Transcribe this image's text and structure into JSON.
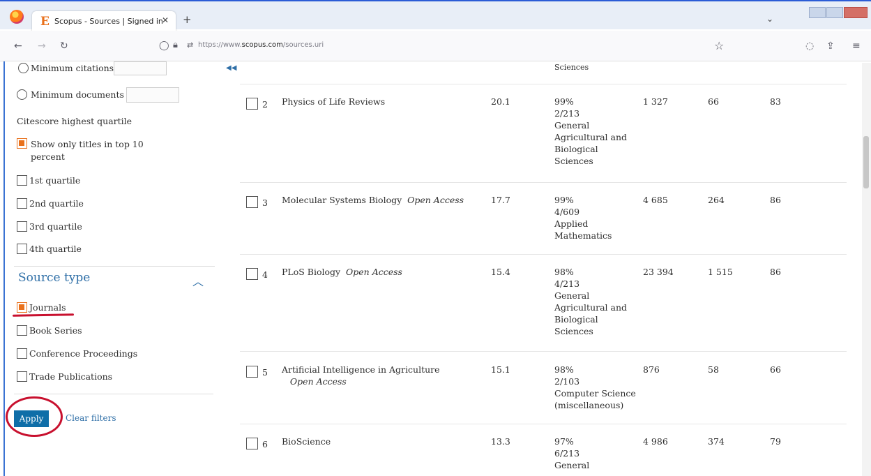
{
  "browser": {
    "tab_favicon": "E",
    "tab_title": "Scopus - Sources | Signed in",
    "tab_close": "✕",
    "new_tab": "+",
    "tab_list": "⌄",
    "url_prefix": "https://www.",
    "url_domain": "scopus.com",
    "url_path": "/sources.uri",
    "icons": [
      "back-icon",
      "forward-icon",
      "reload-icon",
      "shield-icon",
      "lock-icon",
      "permissions-icon",
      "bookmark-star-icon",
      "pocket-icon",
      "share-icon",
      "menu-icon"
    ]
  },
  "filters": {
    "min_citations_label": "Minimum citations",
    "min_documents_label": "Minimum documents",
    "quartile_heading": "Citescore highest quartile",
    "top10_label": "Show only titles in top 10\npercent",
    "quartiles": [
      "1st quartile",
      "2nd quartile",
      "3rd quartile",
      "4th quartile"
    ],
    "source_type_heading": "Source type",
    "source_types": [
      "Journals",
      "Book Series",
      "Conference Proceedings",
      "Trade Publications"
    ],
    "apply_label": "Apply",
    "clear_label": "Clear filters",
    "accent_color": "#2f6fa7",
    "checked_color": "#e9711c",
    "annotation_color": "#c8102e"
  },
  "results": {
    "partial_top_subject": "Sciences",
    "rows": [
      {
        "rank": "2",
        "title": "Physics of Life Reviews",
        "oa": "",
        "citescore": "20.1",
        "percentile": "99%\n2/213\nGeneral\nAgricultural and\nBiological\nSciences",
        "citations": "1 327",
        "documents": "66",
        "cited": "83"
      },
      {
        "rank": "3",
        "title": "Molecular Systems Biology",
        "oa": "Open Access",
        "citescore": "17.7",
        "percentile": "99%\n4/609\nApplied\nMathematics",
        "citations": "4 685",
        "documents": "264",
        "cited": "86"
      },
      {
        "rank": "4",
        "title": "PLoS Biology",
        "oa": "Open Access",
        "citescore": "15.4",
        "percentile": "98%\n4/213\nGeneral\nAgricultural and\nBiological\nSciences",
        "citations": "23 394",
        "documents": "1 515",
        "cited": "86"
      },
      {
        "rank": "5",
        "title": "Artificial Intelligence in Agriculture",
        "oa": "Open Access",
        "citescore": "15.1",
        "percentile": "98%\n2/103\nComputer Science\n(miscellaneous)",
        "citations": "876",
        "documents": "58",
        "cited": "66"
      },
      {
        "rank": "6",
        "title": "BioScience",
        "oa": "",
        "citescore": "13.3",
        "percentile": "97%\n6/213\nGeneral",
        "citations": "4 986",
        "documents": "374",
        "cited": "79"
      }
    ]
  }
}
